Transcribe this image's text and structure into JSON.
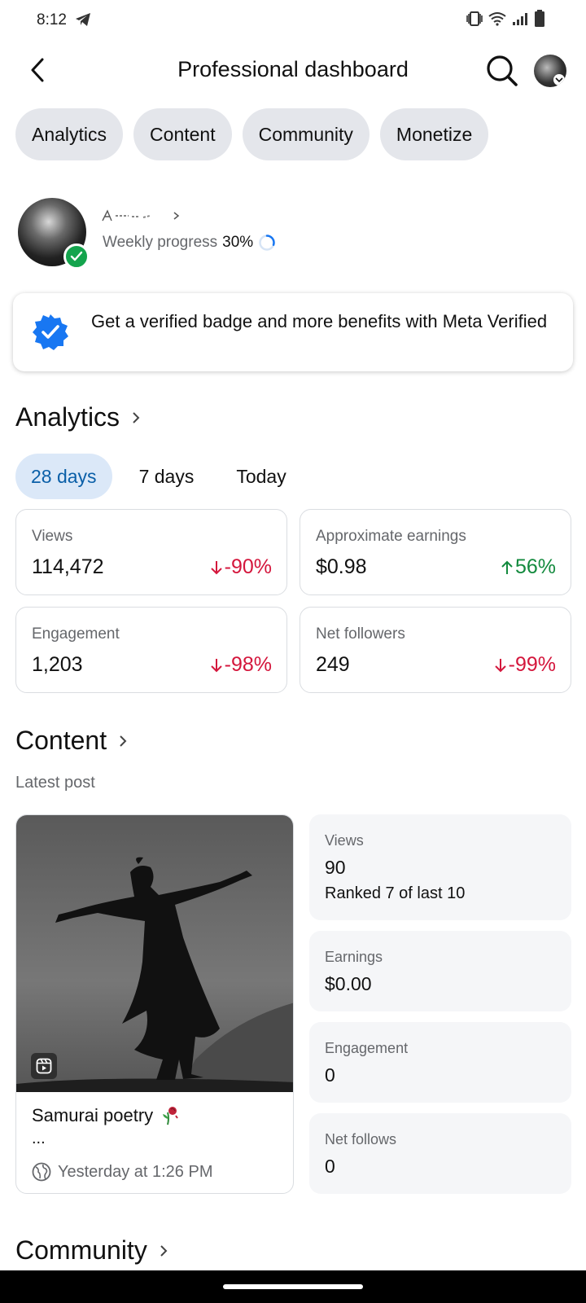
{
  "status_bar": {
    "time": "8:12"
  },
  "header": {
    "title": "Professional dashboard"
  },
  "chips": [
    "Analytics",
    "Content",
    "Community",
    "Monetize"
  ],
  "profile": {
    "progress_label": "Weekly progress",
    "progress_value": "30%",
    "progress_fraction": 0.3
  },
  "verified_banner": {
    "text": "Get a verified badge and more benefits with Meta Verified"
  },
  "analytics": {
    "title": "Analytics",
    "ranges": [
      "28 days",
      "7 days",
      "Today"
    ],
    "selected_range": "28 days",
    "stats": [
      {
        "label": "Views",
        "value": "114,472",
        "change": "-90%",
        "direction": "down"
      },
      {
        "label": "Approximate earnings",
        "value": "$0.98",
        "change": "56%",
        "direction": "up"
      },
      {
        "label": "Engagement",
        "value": "1,203",
        "change": "-98%",
        "direction": "down"
      },
      {
        "label": "Net followers",
        "value": "249",
        "change": "-99%",
        "direction": "down"
      }
    ]
  },
  "content": {
    "title": "Content",
    "subtitle": "Latest post",
    "post": {
      "title": "Samurai poetry",
      "ellipsis": "...",
      "time": "Yesterday at 1:26 PM"
    },
    "metrics": [
      {
        "label": "Views",
        "value": "90",
        "sub": "Ranked 7 of last 10"
      },
      {
        "label": "Earnings",
        "value": "$0.00"
      },
      {
        "label": "Engagement",
        "value": "0"
      },
      {
        "label": "Net follows",
        "value": "0"
      }
    ]
  },
  "community": {
    "title": "Community"
  },
  "colors": {
    "negative": "#d4163c",
    "positive": "#138a3e",
    "accent": "#0a5fa8",
    "verified": "#1877f2"
  }
}
